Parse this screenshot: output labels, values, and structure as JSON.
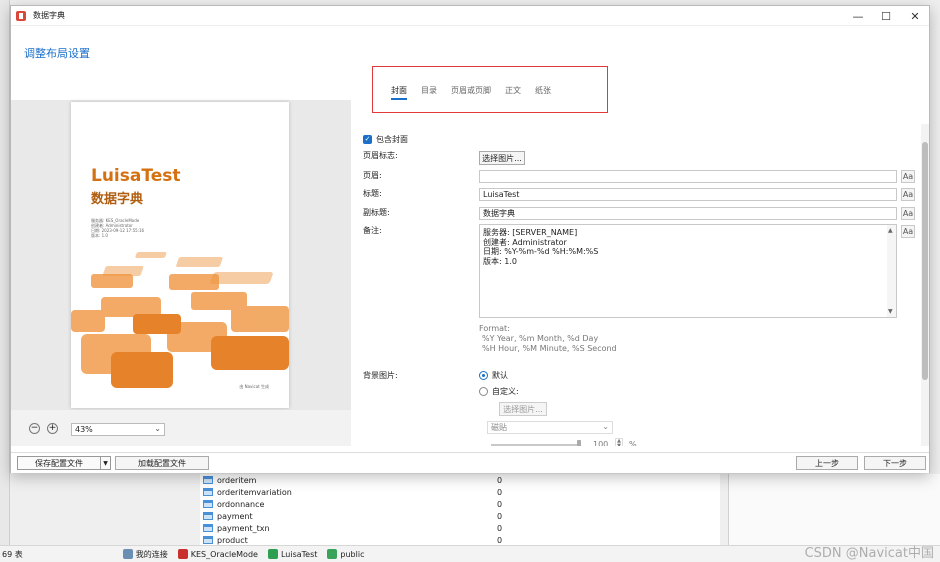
{
  "window": {
    "title": "数据字典",
    "controls": {
      "minimize": "—",
      "maximize": "☐",
      "close": "✕"
    }
  },
  "header": {
    "title": "调整布局设置"
  },
  "tabs": [
    {
      "label": "封面",
      "active": true
    },
    {
      "label": "目录",
      "active": false
    },
    {
      "label": "页眉或页脚",
      "active": false
    },
    {
      "label": "正文",
      "active": false
    },
    {
      "label": "纸张",
      "active": false
    }
  ],
  "preview": {
    "cover_title": "LuisaTest",
    "cover_subtitle": "数据字典",
    "info_lines": [
      "服务器: KES_OracleMode",
      "创建者: Administrator",
      "日期: 2023-09-12 17:55:16",
      "版本: 1.0"
    ],
    "footer": "由 Navicat 生成",
    "zoom_value": "43%",
    "zoom_minus": "−",
    "zoom_plus": "+",
    "accent_color": "#d47212"
  },
  "form": {
    "include_cover_label": "包含封面",
    "include_cover_checked": true,
    "header_logo_label": "页眉标志:",
    "choose_image_button": "选择图片...",
    "page_header_label": "页眉:",
    "page_header_value": "",
    "title_label": "标题:",
    "title_value": "LuisaTest",
    "subtitle_label": "副标题:",
    "subtitle_value": "数据字典",
    "notes_label": "备注:",
    "notes_lines": [
      "服务器: [SERVER_NAME]",
      "创建者: Administrator",
      "日期: %Y-%m-%d %H:%M:%S",
      "版本: 1.0"
    ],
    "font_button": "Aa",
    "format_help": [
      "Format:",
      "%Y Year, %m Month, %d Day",
      "%H Hour, %M Minute, %S Second"
    ],
    "bg_image_label": "背景图片:",
    "bg_default_label": "默认",
    "bg_custom_label": "自定义:",
    "bg_choose_image_button": "选择图片...",
    "tile_select_value": "磁贴",
    "opacity_value": "100",
    "opacity_unit": "%"
  },
  "bottombar": {
    "save_config": "保存配置文件",
    "load_config": "加载配置文件",
    "prev": "上一步",
    "next": "下一步"
  },
  "background": {
    "rows": [
      {
        "name": "orderitem",
        "count": "0"
      },
      {
        "name": "orderitemvariation",
        "count": "0"
      },
      {
        "name": "ordonnance",
        "count": "0"
      },
      {
        "name": "payment",
        "count": "0"
      },
      {
        "name": "payment_txn",
        "count": "0"
      },
      {
        "name": "product",
        "count": "0"
      }
    ],
    "status_count": "69 表",
    "status_items": [
      "我的连接",
      "KES_OracleMode",
      "LuisaTest",
      "public"
    ],
    "watermark": "CSDN @Navicat中国"
  }
}
